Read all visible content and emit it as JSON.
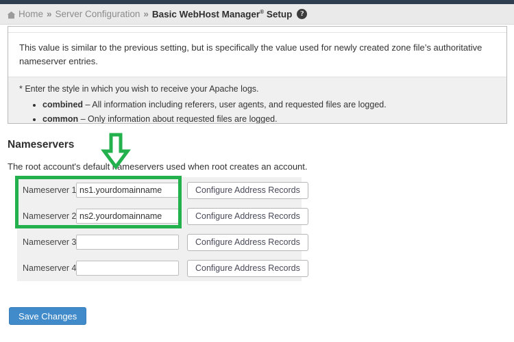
{
  "topbar": {
    "color": "#2e3e50"
  },
  "breadcrumb": {
    "home_label": "Home",
    "sep": "»",
    "items": [
      {
        "label": "Home",
        "icon": "home-icon"
      },
      {
        "label": "Server Configuration"
      }
    ],
    "current": "Basic WebHost Manager",
    "current_suffix": "Setup",
    "registered_mark": "®",
    "help_icon_label": "?"
  },
  "info_panel": {
    "paragraph": "This value is similar to the previous setting, but is specifically the value used for newly created zone file’s authoritative nameserver entries.",
    "note": "* Enter the style in which you wish to receive your Apache logs.",
    "bullets": [
      {
        "term": "combined",
        "dash": "–",
        "text": "All information including referers, user agents, and requested files are logged."
      },
      {
        "term": "common",
        "dash": "–",
        "text": "Only information about requested files are logged."
      }
    ]
  },
  "nameservers": {
    "title": "Nameservers",
    "description": "The root account's default nameservers used when root creates an account.",
    "rows": [
      {
        "label": "Nameserver 1:",
        "value": "ns1.yourdomainname",
        "placeholder": "",
        "button": "Configure Address Records"
      },
      {
        "label": "Nameserver 2:",
        "value": "ns2.yourdomainname",
        "placeholder": "",
        "button": "Configure Address Records"
      },
      {
        "label": "Nameserver 3:",
        "value": "",
        "placeholder": "",
        "button": "Configure Address Records"
      },
      {
        "label": "Nameserver 4:",
        "value": "",
        "placeholder": "",
        "button": "Configure Address Records"
      }
    ]
  },
  "annotations": {
    "arrow_color": "#22b14c",
    "highlight_color": "#22b14c"
  },
  "footer": {
    "save_label": "Save Changes",
    "save_color": "#428bca"
  }
}
